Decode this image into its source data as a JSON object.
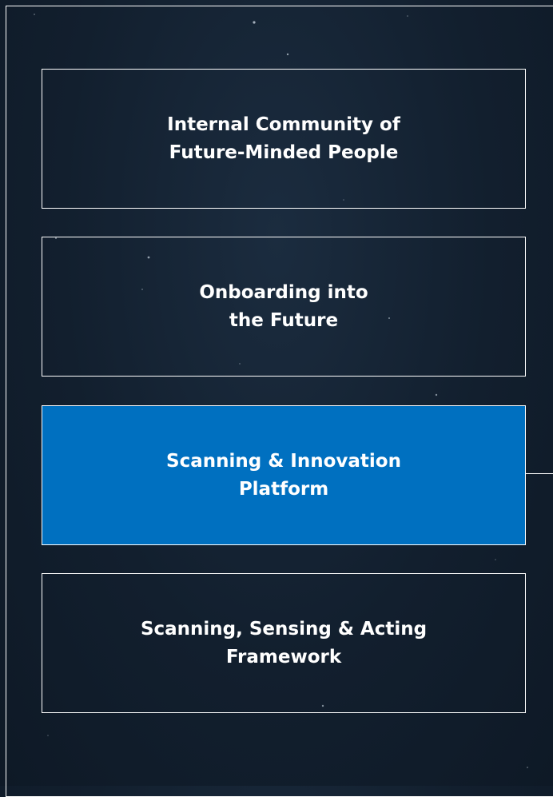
{
  "diagram": {
    "boxes": [
      {
        "label": "Internal Community of\nFuture-Minded People",
        "highlighted": false
      },
      {
        "label": "Onboarding into\nthe Future",
        "highlighted": false
      },
      {
        "label": "Scanning & Innovation\nPlatform",
        "highlighted": true
      },
      {
        "label": "Scanning, Sensing & Acting\nFramework",
        "highlighted": false
      }
    ],
    "colors": {
      "background": "#121f2e",
      "highlight": "#0070c0",
      "border": "#ffffff",
      "text": "#ffffff"
    }
  }
}
